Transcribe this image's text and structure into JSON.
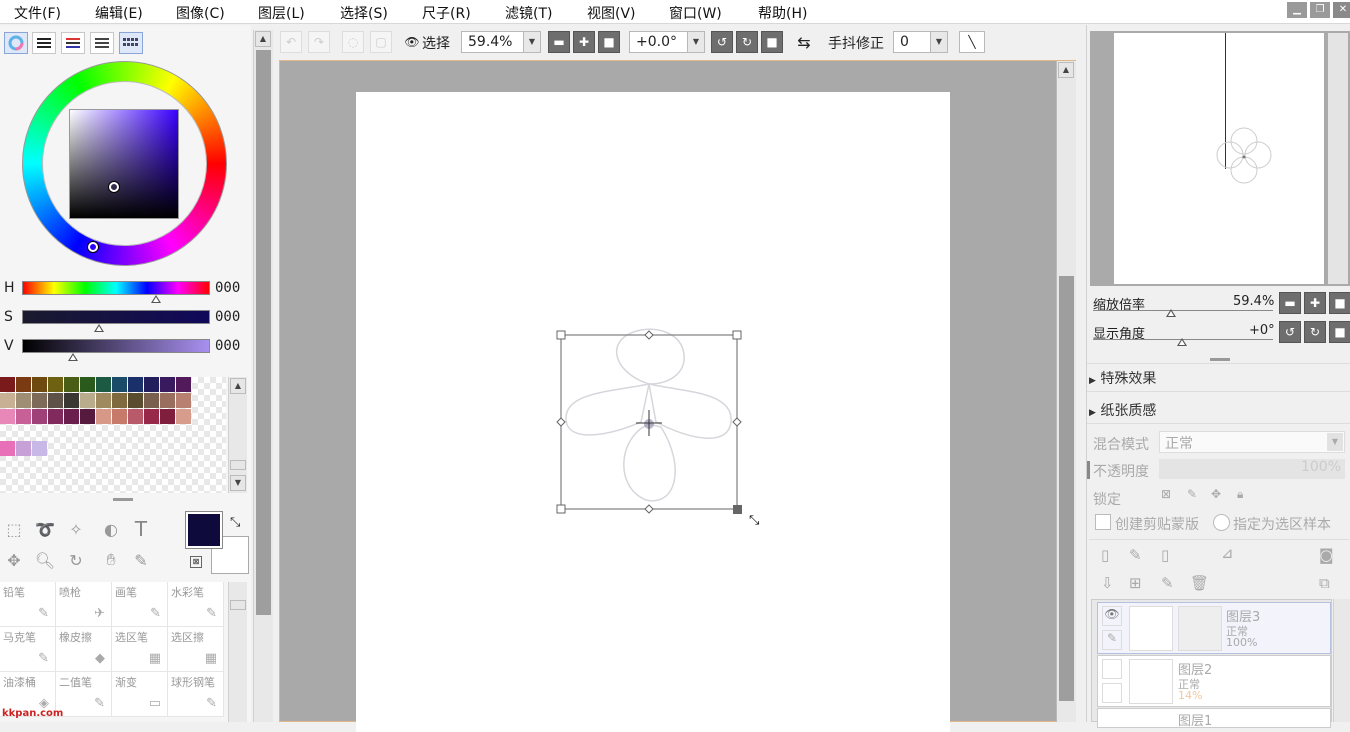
{
  "menubar": {
    "items": [
      "文件(F)",
      "编辑(E)",
      "图像(C)",
      "图层(L)",
      "选择(S)",
      "尺子(R)",
      "滤镜(T)",
      "视图(V)",
      "窗口(W)",
      "帮助(H)"
    ]
  },
  "color_panel": {
    "h_label": "H",
    "s_label": "S",
    "v_label": "V",
    "h_value": "000",
    "s_value": "000",
    "v_value": "000",
    "primary_color": "#0f0a3c",
    "secondary_color": "#ffffff"
  },
  "swatches": {
    "row1": [
      "#7a1a1a",
      "#7a3a12",
      "#6e4a10",
      "#6e6212",
      "#4a5e16",
      "#2a5a1c",
      "#1c5a44",
      "#1a4c6a",
      "#1a306a",
      "#221e5e",
      "#3a1a5e",
      "#521a5a"
    ],
    "row2": [
      "#c8b094",
      "#a08e74",
      "#7e6a58",
      "#5e5248",
      "#3a3632",
      "#b8ac8c",
      "#9e8a5e",
      "#7e6a3e",
      "#5a4c2e",
      "#7a5e4e",
      "#9a6e5e",
      "#b88070"
    ],
    "row3": [
      "#e888b8",
      "#c86098",
      "#a04078",
      "#802a5e",
      "#6a1e4e",
      "#561a3e",
      "#d89888",
      "#c87a6a",
      "#b85a6a",
      "#98284a",
      "#801e3e",
      "#d89c8c"
    ],
    "row4": [
      "#e870b8",
      "#c8a0d8",
      "#c8b8e8"
    ]
  },
  "tools": {
    "brushes": [
      {
        "label": "铅笔",
        "icon": "✎"
      },
      {
        "label": "喷枪",
        "icon": "✈"
      },
      {
        "label": "画笔",
        "icon": "✎"
      },
      {
        "label": "水彩笔",
        "icon": "✎"
      },
      {
        "label": "马克笔",
        "icon": "✎"
      },
      {
        "label": "橡皮擦",
        "icon": "◆"
      },
      {
        "label": "选区笔",
        "icon": "▦"
      },
      {
        "label": "选区擦",
        "icon": "▦"
      },
      {
        "label": "油漆桶",
        "icon": "◈"
      },
      {
        "label": "二值笔",
        "icon": "✎"
      },
      {
        "label": "渐变",
        "icon": "▭"
      },
      {
        "label": "球形钢笔",
        "icon": "✎"
      }
    ]
  },
  "toolbar": {
    "select_label": "选择",
    "zoom_value": "59.4%",
    "rotation_value": "+0.0°",
    "stabilizer_label": "手抖修正",
    "stabilizer_value": "0"
  },
  "navigator": {
    "zoom_label": "缩放倍率",
    "zoom_value": "59.4%",
    "angle_label": "显示角度",
    "angle_value": "+0°"
  },
  "layer_panel": {
    "effects_label": "特殊效果",
    "texture_label": "纸张质感",
    "blend_mode_label": "混合模式",
    "blend_mode_value": "正常",
    "opacity_label": "不透明度",
    "opacity_value": "100%",
    "lock_label": "锁定",
    "clip_label": "创建剪贴蒙版",
    "selection_source_label": "指定为选区样本",
    "layers": [
      {
        "name": "图层3",
        "mode": "正常",
        "opacity": "100%"
      },
      {
        "name": "图层2",
        "mode": "正常",
        "opacity": "14%"
      },
      {
        "name": "图层1",
        "mode": "",
        "opacity": ""
      }
    ]
  },
  "watermark": {
    "left": "kkpan.com"
  }
}
